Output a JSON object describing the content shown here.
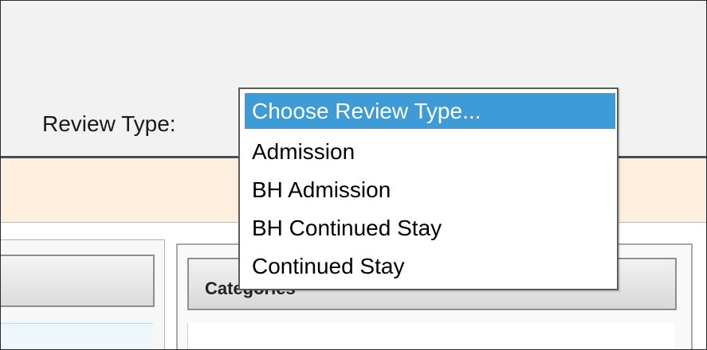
{
  "review_type": {
    "label": "Review Type:",
    "dropdown": {
      "selected": "Choose Review Type...",
      "options": [
        "Choose Review Type...",
        "Admission",
        "BH Admission",
        "BH Continued Stay",
        "Continued Stay"
      ]
    }
  },
  "panels": {
    "categories_title": "Categories"
  },
  "colors": {
    "selected_option": "#3d9bd8",
    "notice_band": "#fdeedd"
  }
}
